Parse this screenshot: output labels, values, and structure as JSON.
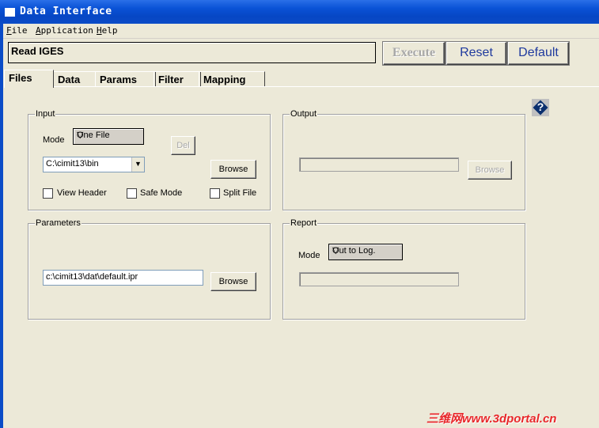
{
  "window": {
    "title": "Data Interface"
  },
  "menu": [
    "File",
    "Application",
    "Help"
  ],
  "toolbar": {
    "command_text": "Read IGES",
    "execute_label": "Execute",
    "reset_label": "Reset",
    "default_label": "Default"
  },
  "tabs": [
    "Files",
    "Data",
    "Params",
    "Filter",
    "Mapping"
  ],
  "input": {
    "legend": "Input",
    "mode_label": "Mode",
    "mode_value": "One File",
    "del_label": "Del",
    "path_value": "C:\\cimit13\\bin",
    "browse_label": "Browse",
    "checkboxes": [
      "View Header",
      "Safe Mode",
      "Split File"
    ]
  },
  "output": {
    "legend": "Output",
    "browse_label": "Browse"
  },
  "parameters": {
    "legend": "Parameters",
    "path_value": "c:\\cimit13\\dat\\default.ipr",
    "browse_label": "Browse"
  },
  "report": {
    "legend": "Report",
    "mode_label": "Mode",
    "mode_value": "Out to Log."
  },
  "help": {
    "glyph": "?"
  },
  "watermark": "三维网www.3dportal.cn",
  "icons": {
    "combo_arrow": "▽",
    "dropdown_arrow": "▼"
  }
}
